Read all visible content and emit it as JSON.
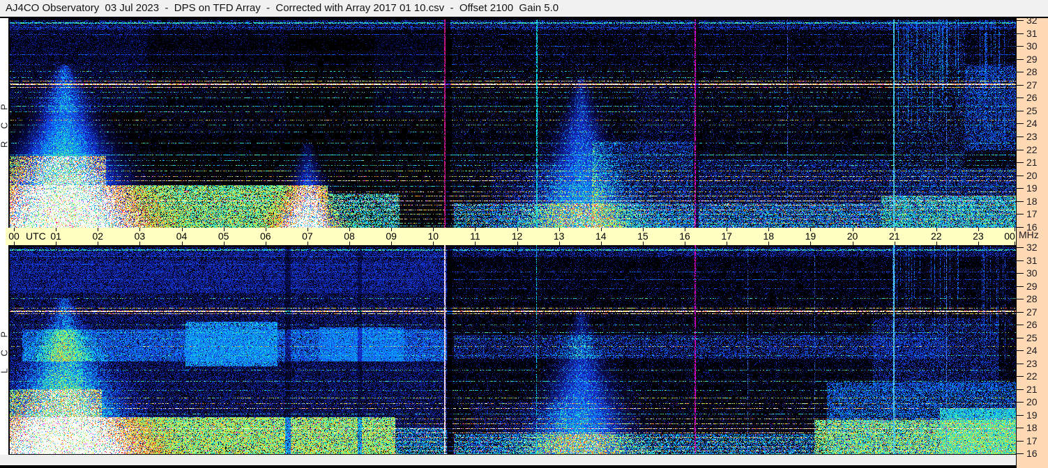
{
  "title_bar": {
    "text": "AJ4CO Observatory  03 Jul 2023  -  DPS on TFD Array  -  Corrected with Array 2017 01 10.csv  -  Offset 2100  Gain 5.0"
  },
  "panels": [
    {
      "id": "rcp",
      "label": "R C P"
    },
    {
      "id": "lcp",
      "label": "L C P"
    }
  ],
  "time_axis": {
    "utc_label": "UTC",
    "hours": [
      "00",
      "01",
      "02",
      "03",
      "04",
      "05",
      "06",
      "07",
      "08",
      "09",
      "10",
      "11",
      "12",
      "13",
      "14",
      "15",
      "16",
      "17",
      "18",
      "19",
      "20",
      "21",
      "22",
      "23",
      "00"
    ]
  },
  "freq_axis": {
    "unit": "MHz",
    "ticks": [
      32,
      31,
      30,
      29,
      28,
      27,
      26,
      25,
      24,
      23,
      22,
      21,
      20,
      19,
      18,
      17,
      16
    ]
  },
  "colors": {
    "titlebar_bg": "#f1f1f1",
    "time_band_bg": "#ffffc2",
    "freq_band_bg": "#ffd9b3",
    "chrome_bg": "#ffffff",
    "border": "#000000"
  },
  "chart_data": {
    "type": "heatmap",
    "title": "AJ4CO Observatory  03 Jul 2023  -  DPS on TFD Array  -  Corrected with Array 2017 01 10.csv  -  Offset 2100  Gain 5.0",
    "xlabel": "UTC",
    "ylabel": "MHz",
    "x_range_hours": [
      0,
      24
    ],
    "y_range_mhz": [
      16,
      32
    ],
    "panels": [
      "RCP dynamic spectrum",
      "LCP dynamic spectrum"
    ],
    "notable_features": [
      "broad burst fan at 01:20 UTC reaching yellow-green intensity below 20 MHz in both polarizations",
      "burst fan at 13:40 UTC, blue-cyan, both polarizations",
      "strong RFI band near 27 MHz (white/yellow/red) across both panels",
      "dense colorful RFI striping between 16 and 19 MHz",
      "vertical event lines near 10:22, 12:33, 16:20, 18:33, 21:05 and 22:20 UTC",
      "diffuse daytime blue emission 03-10 UTC strongest in LCP near 23-26 MHz"
    ]
  },
  "spectrogram_render": {
    "_format": {
      "speckle_zones": "[t0,t1,fLow,fHigh,density,vLow,vHigh]",
      "band_fills": "[t0,t1,fLow,fHigh,coverage,vLow,vHigh]",
      "fans": "[tCenter,fTop,ampTop,ampBottom,sigmaTopHours,sigmaBottomHours]",
      "h_lines": "[freqMHz,hue,coverage,thicknessPx,speckleProb,t0,t1]",
      "v_lines": "[tHours,widthPx,r,g,b,coverage]",
      "dark_cols": "[tHours,widthPx,multiplier]",
      "v_streaks": "[t0,t1,count,fReachLow,fReachHigh,value]"
    },
    "hue_values": {
      "b": 0.34,
      "c": 0.55,
      "g": 0.72,
      "y": 0.82,
      "o": 0.9,
      "r": 0.96,
      "w": 1.0
    },
    "palette": [
      [
        0,
        0,
        0,
        0
      ],
      [
        0.08,
        4,
        4,
        40
      ],
      [
        0.2,
        8,
        22,
        120
      ],
      [
        0.33,
        24,
        64,
        245
      ],
      [
        0.47,
        0,
        160,
        255
      ],
      [
        0.58,
        30,
        225,
        215
      ],
      [
        0.68,
        110,
        245,
        130
      ],
      [
        0.78,
        210,
        245,
        70
      ],
      [
        0.86,
        255,
        205,
        40
      ],
      [
        0.92,
        255,
        130,
        25
      ],
      [
        0.97,
        255,
        45,
        40
      ],
      [
        1,
        255,
        255,
        255
      ]
    ],
    "rcp": {
      "seed": 1234567,
      "speckle_zones": [
        [
          0,
          24,
          16,
          32,
          0.05,
          0.1,
          0.3
        ],
        [
          10.55,
          24,
          16,
          32,
          0.08,
          0.1,
          0.32
        ],
        [
          0,
          3.3,
          25,
          31.6,
          0.38,
          0.1,
          0.24
        ],
        [
          3.3,
          6.6,
          23,
          31.3,
          0.12,
          0.1,
          0.2
        ],
        [
          8.7,
          10.45,
          24.5,
          31,
          0.3,
          0.08,
          0.17
        ],
        [
          0,
          24,
          31.3,
          32,
          0.4,
          0.15,
          0.38
        ],
        [
          13.9,
          16.3,
          16,
          22.6,
          0.42,
          0.15,
          0.45
        ],
        [
          16.4,
          21.0,
          16,
          21.2,
          0.35,
          0.12,
          0.4
        ],
        [
          21.0,
          24,
          16,
          20.5,
          0.45,
          0.15,
          0.45
        ],
        [
          21.15,
          22.8,
          20.5,
          32,
          0.18,
          0.15,
          0.45
        ],
        [
          22.8,
          24,
          22,
          28.5,
          0.5,
          0.18,
          0.45
        ],
        [
          11.5,
          13.2,
          16,
          21,
          0.3,
          0.12,
          0.35
        ],
        [
          14.9,
          16.35,
          22,
          27,
          0.2,
          0.1,
          0.3
        ]
      ],
      "band_fills": [
        [
          0,
          7.6,
          16,
          19.2,
          0.8,
          0.5,
          0.85
        ],
        [
          0,
          2.3,
          19.2,
          21.5,
          0.55,
          0.45,
          0.8
        ],
        [
          7.6,
          9.3,
          16,
          18.6,
          0.55,
          0.4,
          0.7
        ],
        [
          10.6,
          20.8,
          16,
          17.8,
          0.45,
          0.3,
          0.6
        ],
        [
          20.8,
          24,
          16,
          18.4,
          0.6,
          0.4,
          0.7
        ]
      ],
      "fans": [
        [
          1.3,
          28.5,
          0.3,
          0.95,
          0.1,
          1.2
        ],
        [
          7.1,
          22.5,
          0.12,
          0.7,
          0.07,
          0.5
        ],
        [
          13.62,
          27.5,
          0.22,
          0.62,
          0.07,
          0.85
        ]
      ],
      "h_lines": [
        [
          31.85,
          "c",
          0.75,
          2,
          0
        ],
        [
          31.45,
          "b",
          0.5,
          1,
          0
        ],
        [
          30.9,
          "b",
          0.45,
          1,
          0
        ],
        [
          30.0,
          "b",
          0.35,
          1,
          0,
          10.5,
          24
        ],
        [
          29.35,
          "b",
          0.55,
          1,
          0
        ],
        [
          28.6,
          "b",
          0.3,
          1,
          0
        ],
        [
          28.05,
          "c",
          0.35,
          1,
          0
        ],
        [
          27.6,
          "c",
          0.3,
          1,
          0
        ],
        [
          27.3,
          "y",
          0.65,
          1,
          0.08
        ],
        [
          27.1,
          "w",
          0.95,
          2,
          0.16
        ],
        [
          26.85,
          "o",
          0.7,
          1,
          0.1
        ],
        [
          26.45,
          "c",
          0.3,
          1,
          0
        ],
        [
          26.0,
          "c",
          0.35,
          1,
          0
        ],
        [
          25.35,
          "c",
          0.5,
          1,
          0
        ],
        [
          24.95,
          "c",
          0.4,
          1,
          0.04
        ],
        [
          24.3,
          "y",
          0.3,
          1,
          0
        ],
        [
          23.9,
          "c",
          0.3,
          1,
          0
        ],
        [
          23.35,
          "c",
          0.25,
          1,
          0
        ],
        [
          22.5,
          "c",
          0.4,
          1,
          0
        ],
        [
          21.6,
          "c",
          0.7,
          1,
          0
        ],
        [
          21.15,
          "c",
          0.35,
          1,
          0
        ],
        [
          20.8,
          "c",
          0.4,
          1,
          0
        ],
        [
          20.35,
          "g",
          0.5,
          1,
          0
        ],
        [
          19.95,
          "y",
          0.4,
          1,
          0.05
        ],
        [
          19.6,
          "o",
          0.6,
          1,
          0.06
        ],
        [
          19.15,
          "c",
          0.5,
          1,
          0
        ],
        [
          18.75,
          "y",
          0.45,
          1,
          0.05
        ],
        [
          18.4,
          "y",
          0.6,
          1,
          0.1
        ],
        [
          18.05,
          "w",
          0.75,
          1,
          0.12
        ],
        [
          17.7,
          "o",
          0.6,
          1,
          0.08
        ],
        [
          17.35,
          "y",
          0.65,
          1,
          0.06
        ],
        [
          17.0,
          "g",
          0.6,
          1,
          0
        ],
        [
          16.65,
          "y",
          0.5,
          1,
          0.05
        ],
        [
          16.3,
          "g",
          0.55,
          1,
          0
        ],
        [
          16.08,
          "c",
          0.55,
          1,
          0
        ]
      ],
      "v_lines": [
        [
          10.37,
          2,
          200,
          20,
          130,
          0.85
        ],
        [
          12.55,
          2,
          0,
          225,
          255,
          0.8
        ],
        [
          16.33,
          2,
          225,
          0,
          200,
          0.7
        ],
        [
          18.55,
          1,
          50,
          100,
          235,
          0.55
        ],
        [
          21.08,
          2,
          70,
          200,
          255,
          0.95
        ],
        [
          22.33,
          1,
          60,
          120,
          255,
          0.6
        ]
      ],
      "dark_cols": [
        [
          10.45,
          8,
          0.25
        ],
        [
          16.4,
          4,
          0.3
        ]
      ],
      "v_streaks": [
        [
          21.15,
          22.75,
          26,
          23,
          29,
          0.45
        ],
        [
          23.1,
          23.9,
          14,
          22,
          28,
          0.4
        ]
      ]
    },
    "lcp": {
      "seed": 7654321,
      "speckle_zones": [
        [
          0,
          24,
          16,
          32,
          0.06,
          0.1,
          0.3
        ],
        [
          0,
          10.45,
          16.5,
          31,
          0.5,
          0.12,
          0.3
        ],
        [
          0.3,
          10.45,
          23.2,
          25.6,
          0.75,
          0.25,
          0.5
        ],
        [
          4.2,
          6.4,
          22.8,
          26.2,
          0.85,
          0.3,
          0.58
        ],
        [
          7.4,
          9.4,
          23.2,
          25.8,
          0.8,
          0.28,
          0.52
        ],
        [
          0,
          10.45,
          28.5,
          31.7,
          0.5,
          0.15,
          0.33
        ],
        [
          10.55,
          24,
          16,
          32,
          0.08,
          0.1,
          0.3
        ],
        [
          10.6,
          22.4,
          23.4,
          25.2,
          0.4,
          0.18,
          0.42
        ],
        [
          19.5,
          24,
          16,
          21.5,
          0.55,
          0.25,
          0.5
        ],
        [
          22.2,
          24,
          16,
          19.5,
          0.85,
          0.4,
          0.68
        ],
        [
          20.6,
          23.6,
          21,
          26.5,
          0.35,
          0.15,
          0.4
        ],
        [
          0,
          24,
          31.3,
          32,
          0.4,
          0.15,
          0.35
        ],
        [
          11,
          13.3,
          16,
          20,
          0.3,
          0.12,
          0.33
        ]
      ],
      "band_fills": [
        [
          0,
          9.2,
          16,
          18.8,
          0.85,
          0.55,
          0.88
        ],
        [
          0,
          2.2,
          18.8,
          21,
          0.5,
          0.45,
          0.75
        ],
        [
          9.2,
          10.45,
          16,
          18,
          0.5,
          0.35,
          0.6
        ],
        [
          10.6,
          19.2,
          16,
          17.5,
          0.5,
          0.3,
          0.6
        ],
        [
          19.2,
          24,
          16,
          18.6,
          0.75,
          0.5,
          0.85
        ]
      ],
      "fans": [
        [
          1.3,
          28.0,
          0.25,
          0.9,
          0.1,
          1.15
        ],
        [
          13.62,
          27.0,
          0.2,
          0.6,
          0.07,
          0.9
        ]
      ],
      "h_lines": [
        [
          31.85,
          "c",
          0.7,
          2,
          0
        ],
        [
          31.3,
          "b",
          0.55,
          1,
          0,
          0,
          10.5
        ],
        [
          30.7,
          "b",
          0.5,
          1,
          0,
          0,
          10.5
        ],
        [
          30.1,
          "b",
          0.4,
          1,
          0
        ],
        [
          29.5,
          "b",
          0.5,
          1,
          0
        ],
        [
          28.8,
          "b",
          0.35,
          1,
          0
        ],
        [
          28.05,
          "c",
          0.3,
          1,
          0
        ],
        [
          27.3,
          "y",
          0.55,
          1,
          0.06
        ],
        [
          27.1,
          "w",
          0.85,
          2,
          0.13
        ],
        [
          26.85,
          "o",
          0.6,
          1,
          0.08
        ],
        [
          26.0,
          "c",
          0.3,
          1,
          0
        ],
        [
          25.4,
          "c",
          0.4,
          1,
          0
        ],
        [
          24.9,
          "c",
          0.35,
          1,
          0
        ],
        [
          24.3,
          "y",
          0.3,
          1,
          0
        ],
        [
          23.6,
          "c",
          0.3,
          1,
          0
        ],
        [
          22.5,
          "c",
          0.35,
          1,
          0
        ],
        [
          21.6,
          "c",
          0.5,
          1,
          0
        ],
        [
          20.9,
          "c",
          0.35,
          1,
          0
        ],
        [
          20.3,
          "g",
          0.45,
          1,
          0
        ],
        [
          19.9,
          "y",
          0.4,
          1,
          0.04
        ],
        [
          19.5,
          "o",
          0.5,
          1,
          0.05
        ],
        [
          19.1,
          "c",
          0.45,
          1,
          0
        ],
        [
          18.7,
          "y",
          0.5,
          1,
          0.05
        ],
        [
          18.3,
          "y",
          0.55,
          1,
          0.09
        ],
        [
          17.95,
          "w",
          0.7,
          1,
          0.11
        ],
        [
          17.6,
          "o",
          0.6,
          1,
          0.07
        ],
        [
          17.25,
          "y",
          0.6,
          1,
          0.05
        ],
        [
          16.9,
          "g",
          0.55,
          1,
          0
        ],
        [
          16.55,
          "y",
          0.5,
          1,
          0.05
        ],
        [
          16.2,
          "o",
          0.45,
          1,
          0.04
        ],
        [
          16.0,
          "c",
          0.5,
          1,
          0
        ]
      ],
      "v_lines": [
        [
          10.37,
          2,
          255,
          215,
          255,
          0.95
        ],
        [
          12.55,
          1,
          0,
          215,
          255,
          0.65
        ],
        [
          16.33,
          2,
          215,
          0,
          190,
          0.7
        ],
        [
          17.6,
          1,
          50,
          115,
          255,
          0.45
        ],
        [
          19.2,
          1,
          50,
          115,
          255,
          0.45
        ],
        [
          21.08,
          2,
          80,
          195,
          255,
          0.95
        ],
        [
          22.33,
          1,
          60,
          125,
          255,
          0.65
        ]
      ],
      "dark_cols": [
        [
          6.65,
          8,
          0.55
        ],
        [
          8.35,
          6,
          0.6
        ],
        [
          10.5,
          8,
          0.3
        ]
      ],
      "v_streaks": [
        [
          21.0,
          22.7,
          18,
          23,
          29,
          0.4
        ],
        [
          23.2,
          24,
          10,
          22,
          27,
          0.35
        ]
      ]
    }
  }
}
